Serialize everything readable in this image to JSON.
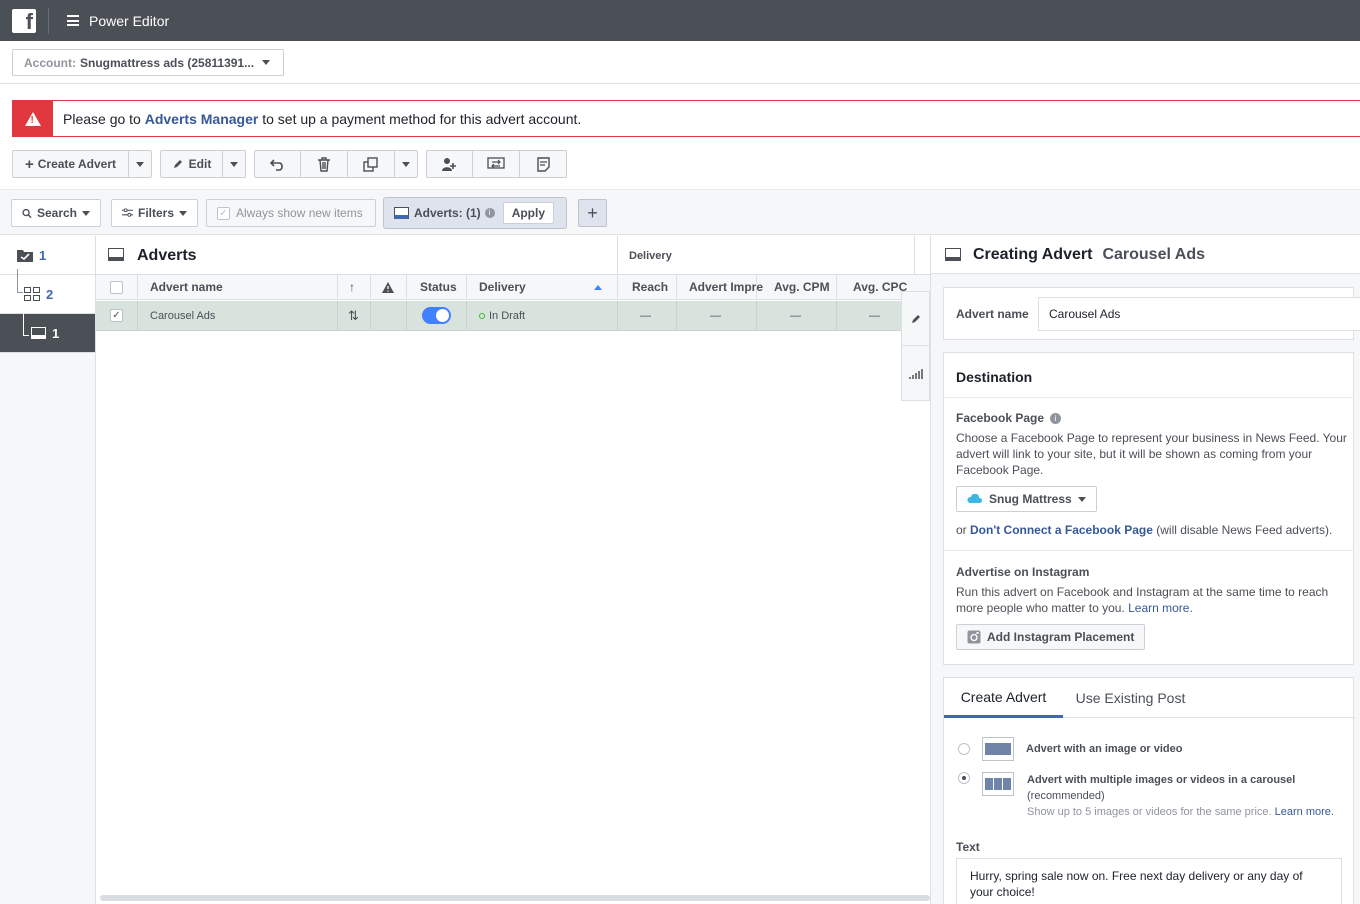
{
  "topbar": {
    "logo": "f",
    "title": "Power Editor"
  },
  "account": {
    "label": "Account:",
    "value": "Snugmattress ads (25811391..."
  },
  "alert": {
    "prefix": "Please go to",
    "link": "Adverts Manager",
    "suffix": "to set up a payment method for this advert account."
  },
  "toolbar": {
    "create_label": "Create Advert",
    "edit_label": "Edit"
  },
  "filters": {
    "search_label": "Search",
    "filters_label": "Filters",
    "always_show_label": "Always show new items",
    "adverts_pill": "Adverts: (1)",
    "apply_label": "Apply",
    "plus_label": "+"
  },
  "leftnav": {
    "campaigns_count": "1",
    "adsets_count": "2",
    "adverts_count": "1"
  },
  "table": {
    "title": "Adverts",
    "group_delivery": "Delivery",
    "columns": {
      "name": "Advert name",
      "status": "Status",
      "delivery": "Delivery",
      "reach": "Reach",
      "impressions": "Advert Impre",
      "cpm": "Avg. CPM",
      "cpc": "Avg. CPC"
    },
    "rows": [
      {
        "name": "Carousel Ads",
        "delivery": "In Draft",
        "reach": "—",
        "impressions": "—",
        "cpm": "—",
        "cpc": "—"
      }
    ]
  },
  "panel": {
    "heading": "Creating Advert",
    "heading_name": "Carousel Ads",
    "advert_name_label": "Advert name",
    "advert_name_value": "Carousel Ads",
    "destination": {
      "title": "Destination",
      "page_label": "Facebook Page",
      "page_help": "Choose a Facebook Page to represent your business in News Feed. Your advert will link to your site, but it will be shown as coming from your Facebook Page.",
      "page_button": "Snug Mattress",
      "or_text": "or",
      "dont_connect_link": "Don't Connect a Facebook Page",
      "dont_connect_suffix": "(will disable News Feed adverts).",
      "instagram_label": "Advertise on Instagram",
      "instagram_help": "Run this advert on Facebook and Instagram at the same time to reach more people who matter to you.",
      "learn_more": "Learn more.",
      "instagram_button": "Add Instagram Placement"
    },
    "tabs": {
      "create": "Create Advert",
      "existing": "Use Existing Post"
    },
    "format": {
      "single_label": "Advert with an image or video",
      "carousel_label": "Advert with multiple images or videos in a carousel",
      "carousel_recommended": "(recommended)",
      "carousel_help": "Show up to 5 images or videos for the same price.",
      "learn_more": "Learn more."
    },
    "text_label": "Text",
    "text_value": "Hurry, spring sale now on. Free next day delivery or any day of your choice!"
  },
  "colors": {
    "topbar": "#4b4f56",
    "alert": "#e0383e",
    "link": "#365899",
    "toggle": "#4080ff",
    "selected_row": "#d9e3dd"
  }
}
